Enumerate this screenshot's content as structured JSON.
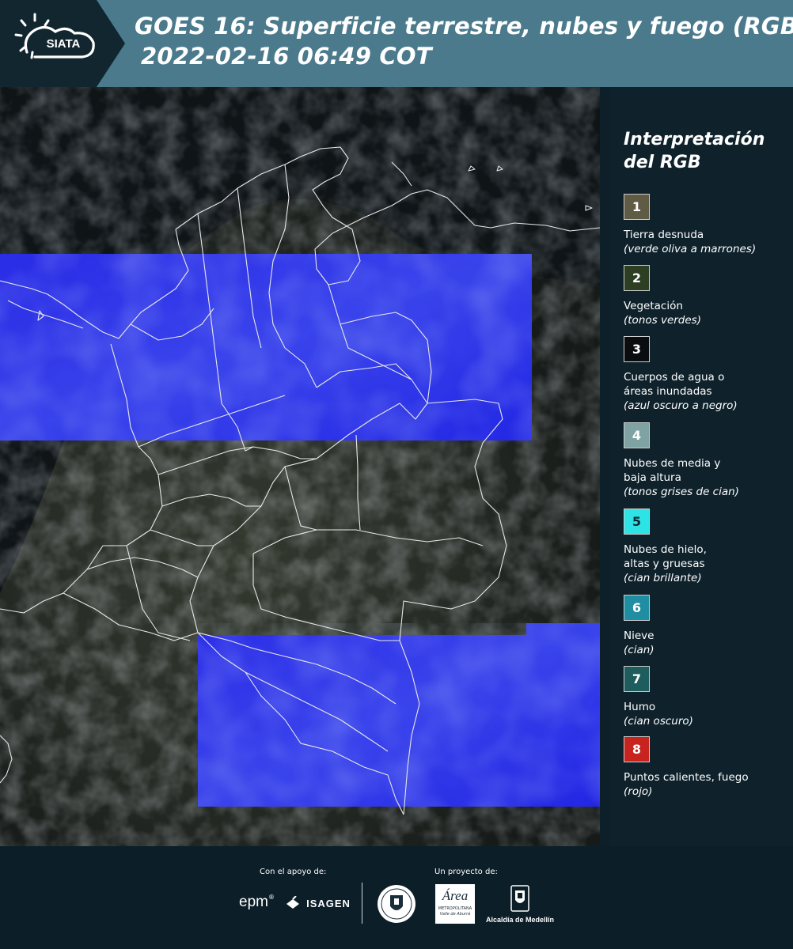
{
  "header": {
    "logo_text": "SIATA",
    "title_line1": "GOES 16: Superficie terrestre, nubes y fuego (RGB)",
    "title_line2": "2022-02-16 06:49 COT"
  },
  "legend": {
    "title_line1": "Interpretación",
    "title_line2": "del RGB",
    "items": [
      {
        "num": "1",
        "label": "Tierra desnuda",
        "sub": "(verde oliva a marrones)",
        "color": "#5f5b44",
        "text": "#ffffff"
      },
      {
        "num": "2",
        "label": "Vegetación",
        "sub": "(tonos verdes)",
        "color": "#2c3f22",
        "text": "#ffffff"
      },
      {
        "num": "3",
        "label": "Cuerpos de agua o\náreas inundadas",
        "sub": "(azul oscuro a negro)",
        "color": "#0a0d10",
        "text": "#ffffff"
      },
      {
        "num": "4",
        "label": "Nubes de media y\nbaja altura",
        "sub": "(tonos grises de cian)",
        "color": "#7fa3a3",
        "text": "#ffffff"
      },
      {
        "num": "5",
        "label": "Nubes de hielo,\naltas y gruesas",
        "sub": "(cian brillante)",
        "color": "#2ee3e6",
        "text": "#0b2a33"
      },
      {
        "num": "6",
        "label": "Nieve",
        "sub": "(cian)",
        "color": "#1f8ea3",
        "text": "#ffffff"
      },
      {
        "num": "7",
        "label": "Humo",
        "sub": "(cian oscuro)",
        "color": "#1f5c5e",
        "text": "#ffffff"
      },
      {
        "num": "8",
        "label": "Puntos calientes, fuego",
        "sub": "(rojo)",
        "color": "#c8241f",
        "text": "#ffffff"
      }
    ]
  },
  "footer": {
    "support_caption": "Con el apoyo de:",
    "project_caption": "Un proyecto de:",
    "epm": "epm",
    "isagen": "ISAGEN",
    "area_main": "Área",
    "area_sub1": "METROPOLITANA",
    "area_sub2": "Valle de Aburrá",
    "alcaldia": "Alcaldía de Medellín"
  },
  "colors": {
    "header_bg": "#4b7a8c",
    "cloud_blue": "#2222f5",
    "border_lines": "#e8e8e8"
  }
}
